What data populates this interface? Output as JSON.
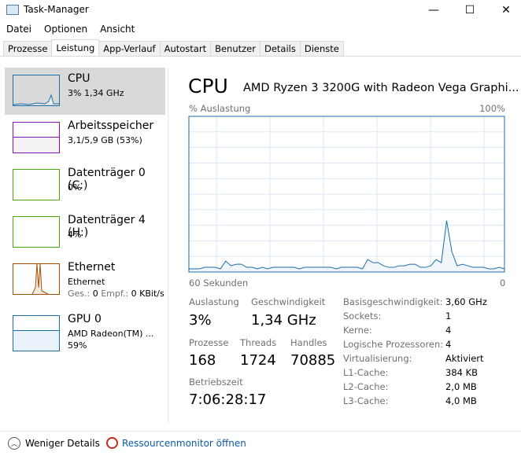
{
  "window": {
    "title": "Task-Manager",
    "minimize": "—",
    "maximize": "☐",
    "close": "✕"
  },
  "menu": [
    "Datei",
    "Optionen",
    "Ansicht"
  ],
  "tabs": [
    "Prozesse",
    "Leistung",
    "App-Verlauf",
    "Autostart",
    "Benutzer",
    "Details",
    "Dienste"
  ],
  "sidebar": [
    {
      "name": "CPU",
      "sub": "3% 1,34 GHz"
    },
    {
      "name": "Arbeitsspeicher",
      "sub": "3,1/5,9 GB (53%)"
    },
    {
      "name": "Datenträger 0 (C:)",
      "sub": "0%"
    },
    {
      "name": "Datenträger 4 (H:)",
      "sub": "4%"
    },
    {
      "name": "Ethernet",
      "sub": "Ethernet",
      "sub2a": "Ges.:",
      "sub2b": " 0 ",
      "sub2c": "Empf.:",
      "sub2d": " 0 KBit/s"
    },
    {
      "name": "GPU 0",
      "sub": "AMD Radeon(TM) ...",
      "sub2": "59%"
    }
  ],
  "header": {
    "title": "CPU",
    "model": "AMD Ryzen 3 3200G with Radeon Vega Graphi..."
  },
  "chart_data": {
    "type": "area",
    "ylabel": "% Auslastung",
    "ymax_label": "100%",
    "xlabel_left": "60 Sekunden",
    "xlabel_right": "0",
    "ylim": [
      0,
      100
    ],
    "values": [
      2,
      2,
      2,
      3,
      3,
      3,
      2,
      7,
      4,
      5,
      5,
      3,
      3,
      2,
      3,
      2,
      3,
      3,
      3,
      3,
      3,
      2,
      3,
      3,
      3,
      3,
      3,
      3,
      2,
      3,
      3,
      3,
      3,
      2,
      8,
      6,
      6,
      4,
      3,
      3,
      4,
      4,
      5,
      5,
      3,
      3,
      4,
      8,
      6,
      33,
      13,
      4,
      5,
      4,
      3,
      3,
      3,
      2,
      2,
      3,
      2
    ],
    "color": "#1b6ea8"
  },
  "stats": {
    "auslastung_label": "Auslastung",
    "auslastung": "3%",
    "geschw_label": "Geschwindigkeit",
    "geschw": "1,34 GHz",
    "prozesse_label": "Prozesse",
    "prozesse": "168",
    "threads_label": "Threads",
    "threads": "1724",
    "handles_label": "Handles",
    "handles": "70885",
    "betrieb_label": "Betriebszeit",
    "betrieb": "7:06:28:17"
  },
  "details": [
    [
      "Basisgeschwindigkeit:",
      "3,60 GHz"
    ],
    [
      "Sockets:",
      "1"
    ],
    [
      "Kerne:",
      "4"
    ],
    [
      "Logische Prozessoren:",
      "4"
    ],
    [
      "Virtualisierung:",
      "Aktiviert"
    ],
    [
      "L1-Cache:",
      "384 KB"
    ],
    [
      "L2-Cache:",
      "2,0 MB"
    ],
    [
      "L3-Cache:",
      "4,0 MB"
    ]
  ],
  "footer": {
    "less": "Weniger Details",
    "resmon": "Ressourcenmonitor öffnen"
  }
}
